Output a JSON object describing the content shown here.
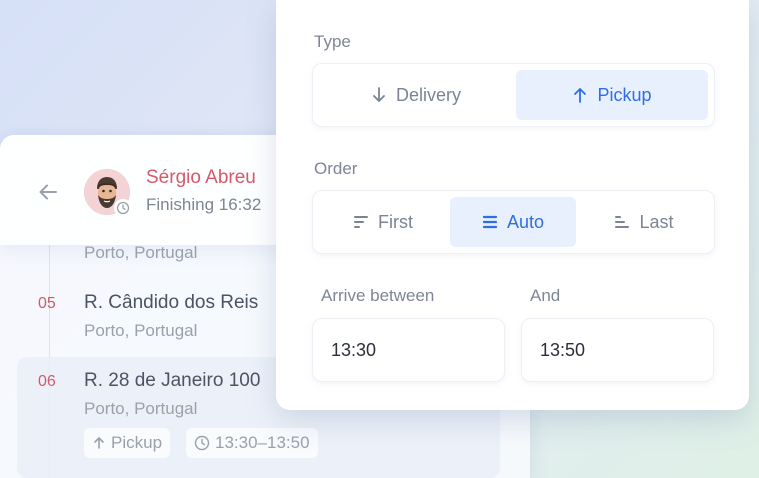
{
  "driver": {
    "name": "Sérgio Abreu",
    "status": "Finishing 16:32"
  },
  "stops": [
    {
      "city": "Porto, Portugal"
    },
    {
      "number": "05",
      "street": "R. Cândido dos Reis",
      "city": "Porto, Portugal"
    },
    {
      "number": "06",
      "street": "R. 28 de Janeiro 100",
      "city": "Porto, Portugal",
      "type_chip": "Pickup",
      "time_chip": "13:30–13:50"
    }
  ],
  "popover": {
    "type": {
      "label": "Type",
      "options": [
        "Delivery",
        "Pickup"
      ],
      "selected": "Pickup"
    },
    "order": {
      "label": "Order",
      "options": [
        "First",
        "Auto",
        "Last"
      ],
      "selected": "Auto"
    },
    "arrive_between": {
      "label": "Arrive between",
      "value": "13:30"
    },
    "and": {
      "label": "And",
      "value": "13:50"
    }
  },
  "colors": {
    "accent": "#2f6ee6",
    "accent_bg": "#e8f0fd",
    "driver_name": "#d8586b",
    "stop_number": "#d05a6c"
  }
}
